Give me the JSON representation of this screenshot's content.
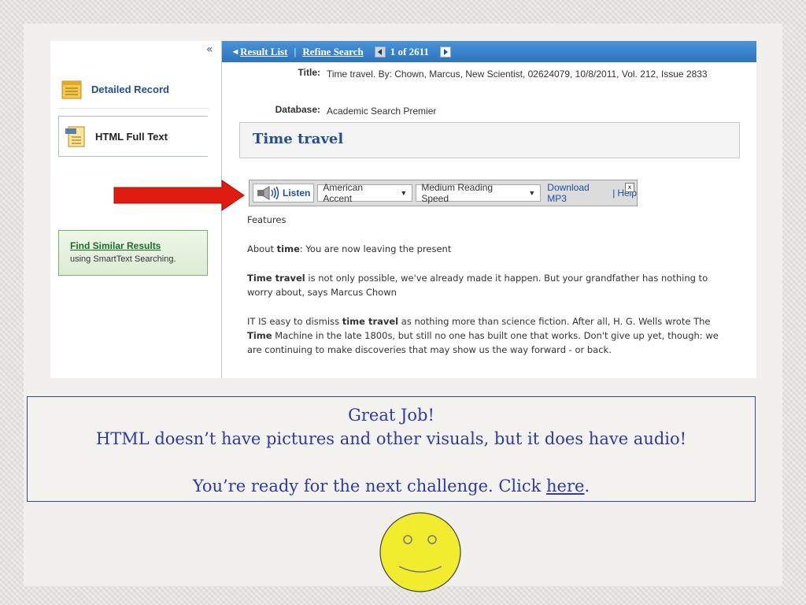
{
  "sidebar": {
    "collapse_glyph": "«",
    "detailed_record": "Detailed Record",
    "html_full_text": "HTML Full Text",
    "find_similar": "Find Similar Results",
    "find_similar_sub": "using SmartText Searching."
  },
  "topbar": {
    "result_list": "Result List",
    "refine_search": "Refine Search",
    "position": "1 of 2611"
  },
  "record": {
    "title_label": "Title:",
    "title_value": "Time travel. By: Chown, Marcus, New Scientist, 02624079, 10/8/2011, Vol. 212, Issue 2833",
    "database_label": "Database:",
    "database_value": "Academic Search Premier",
    "article_title": "Time travel"
  },
  "listen": {
    "button": "Listen",
    "accent": "American Accent",
    "speed": "Medium Reading Speed",
    "download": "Download MP3",
    "pipe": "|",
    "help": "Help",
    "close": "x"
  },
  "article": {
    "section": "Features",
    "p1_a": "About ",
    "p1_b": "time",
    "p1_c": ": You are now leaving the present",
    "p2_a": "Time travel",
    "p2_b": " is not only possible, we've already made it happen. But your grandfather has nothing to worry about, says Marcus Chown",
    "p3_a": "IT IS easy to dismiss ",
    "p3_b": "time travel",
    "p3_c": " as nothing more than science fiction. After all, H. G. Wells wrote The ",
    "p3_d": "Time",
    "p3_e": " Machine in the late 1800s, but still no one has built one that works. Don't give up yet, though: we are continuing to make discoveries that may show us the way forward - or back."
  },
  "message": {
    "line1": "Great Job!",
    "line2": "HTML doesn’t have pictures and other visuals, but it does have audio!",
    "line3_pre": "You’re ready for the next challenge.  Click ",
    "line3_link": "here",
    "line3_post": "."
  },
  "colors": {
    "accent_blue": "#2d74be",
    "arrow_red": "#e01b10",
    "message_text": "#2e3aa6",
    "smiley_yellow": "#f2ec2e"
  },
  "icons": [
    "collapse-icon",
    "detailed-record-icon",
    "html-doc-icon",
    "prev-arrow-icon",
    "next-arrow-icon",
    "speaker-icon",
    "dropdown-caret-icon",
    "red-arrow-icon",
    "smiley-icon"
  ]
}
